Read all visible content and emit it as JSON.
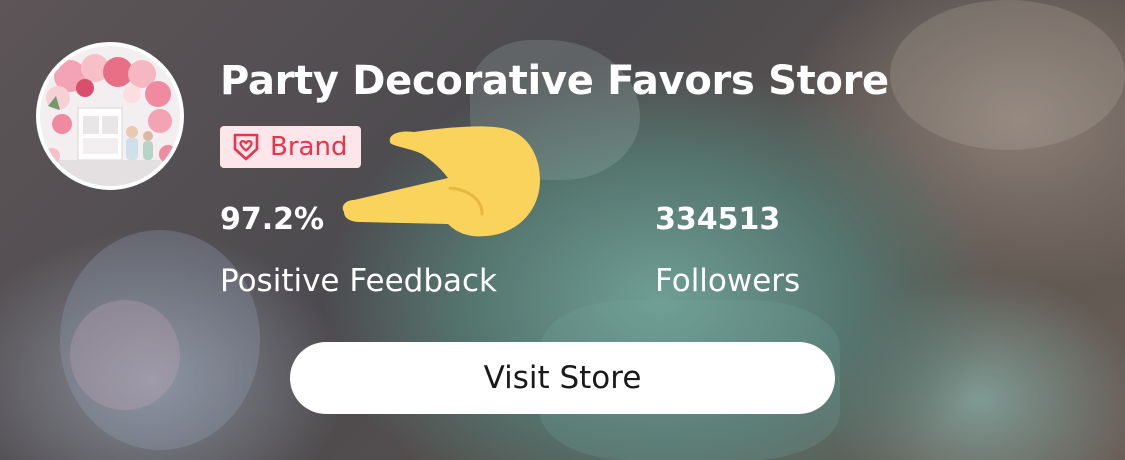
{
  "store": {
    "name": "Party Decorative Favors Store",
    "badge_label": "Brand",
    "positive_feedback_value": "97.2%",
    "positive_feedback_label": "Positive Feedback",
    "followers_value": "334513",
    "followers_label": "Followers"
  },
  "actions": {
    "visit_label": "Visit Store"
  },
  "icons": {
    "badge_icon": "heart-shield-icon",
    "pointer": "pointing-hand-icon"
  },
  "colors": {
    "badge_bg": "#fde6ea",
    "badge_accent": "#e8344e",
    "button_bg": "#ffffff",
    "hand_fill": "#f9d35c"
  }
}
